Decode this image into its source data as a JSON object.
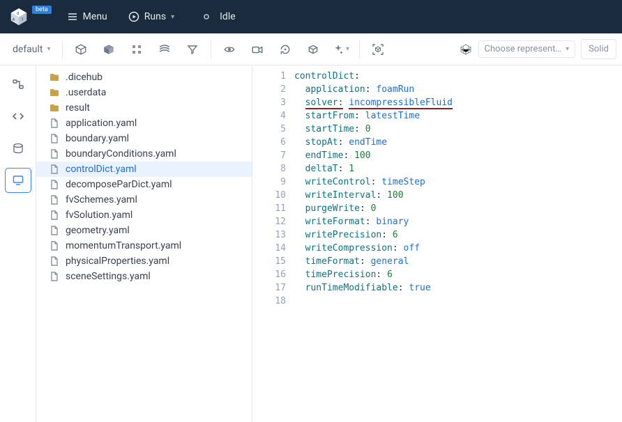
{
  "header": {
    "beta": "beta",
    "menu": "Menu",
    "runs": "Runs",
    "status": "Idle"
  },
  "toolbar": {
    "preset": "default",
    "repr_placeholder": "Choose represent…",
    "solid": "Solid"
  },
  "files": [
    {
      "name": ".dicehub",
      "type": "folder"
    },
    {
      "name": ".userdata",
      "type": "folder"
    },
    {
      "name": "result",
      "type": "folder"
    },
    {
      "name": "application.yaml",
      "type": "file"
    },
    {
      "name": "boundary.yaml",
      "type": "file"
    },
    {
      "name": "boundaryConditions.yaml",
      "type": "file"
    },
    {
      "name": "controlDict.yaml",
      "type": "file",
      "selected": true
    },
    {
      "name": "decomposeParDict.yaml",
      "type": "file"
    },
    {
      "name": "fvSchemes.yaml",
      "type": "file"
    },
    {
      "name": "fvSolution.yaml",
      "type": "file"
    },
    {
      "name": "geometry.yaml",
      "type": "file"
    },
    {
      "name": "momentumTransport.yaml",
      "type": "file"
    },
    {
      "name": "physicalProperties.yaml",
      "type": "file"
    },
    {
      "name": "sceneSettings.yaml",
      "type": "file"
    }
  ],
  "code": {
    "root_key": "controlDict",
    "entries": [
      {
        "key": "application",
        "value": "foamRun",
        "vclass": "s"
      },
      {
        "key": "solver",
        "value": "incompressibleFluid",
        "vclass": "s",
        "underline": true
      },
      {
        "key": "startFrom",
        "value": "latestTime",
        "vclass": "s"
      },
      {
        "key": "startTime",
        "value": "0",
        "vclass": "n"
      },
      {
        "key": "stopAt",
        "value": "endTime",
        "vclass": "s"
      },
      {
        "key": "endTime",
        "value": "100",
        "vclass": "n"
      },
      {
        "key": "deltaT",
        "value": "1",
        "vclass": "n"
      },
      {
        "key": "writeControl",
        "value": "timeStep",
        "vclass": "s"
      },
      {
        "key": "writeInterval",
        "value": "100",
        "vclass": "n"
      },
      {
        "key": "purgeWrite",
        "value": "0",
        "vclass": "n"
      },
      {
        "key": "writeFormat",
        "value": "binary",
        "vclass": "s"
      },
      {
        "key": "writePrecision",
        "value": "6",
        "vclass": "n"
      },
      {
        "key": "writeCompression",
        "value": "off",
        "vclass": "s"
      },
      {
        "key": "timeFormat",
        "value": "general",
        "vclass": "s"
      },
      {
        "key": "timePrecision",
        "value": "6",
        "vclass": "n"
      },
      {
        "key": "runTimeModifiable",
        "value": "true",
        "vclass": "s"
      }
    ],
    "total_lines": 18
  }
}
